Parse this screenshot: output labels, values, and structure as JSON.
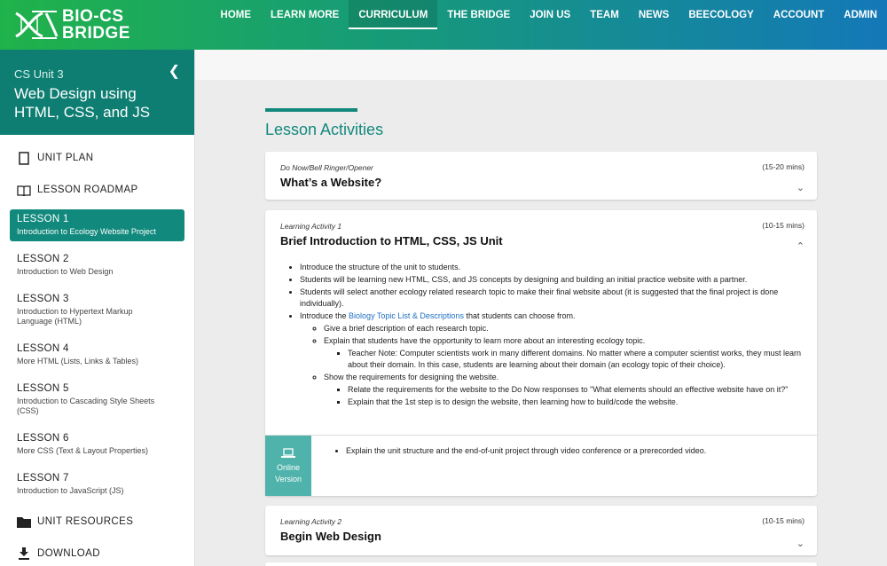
{
  "brand": {
    "line1": "BIO-CS",
    "line2": "BRIDGE"
  },
  "nav": [
    {
      "label": "HOME"
    },
    {
      "label": "LEARN MORE"
    },
    {
      "label": "CURRICULUM"
    },
    {
      "label": "THE BRIDGE"
    },
    {
      "label": "JOIN US"
    },
    {
      "label": "TEAM"
    },
    {
      "label": "NEWS"
    },
    {
      "label": "BEECOLOGY"
    },
    {
      "label": "ACCOUNT"
    },
    {
      "label": "ADMIN"
    }
  ],
  "sidebar": {
    "unit": "CS Unit 3",
    "title": "Web Design using HTML, CSS, and JS",
    "unit_plan": "UNIT PLAN",
    "roadmap": "LESSON ROADMAP",
    "lessons": [
      {
        "name": "LESSON 1",
        "desc": "Introduction to Ecology Website Project"
      },
      {
        "name": "LESSON 2",
        "desc": "Introduction to Web Design"
      },
      {
        "name": "LESSON 3",
        "desc": "Introduction to Hypertext Markup Language (HTML)"
      },
      {
        "name": "LESSON 4",
        "desc": "More HTML (Lists, Links & Tables)"
      },
      {
        "name": "LESSON 5",
        "desc": "Introduction to Cascading Style Sheets (CSS)"
      },
      {
        "name": "LESSON 6",
        "desc": "More CSS (Text & Layout Properties)"
      },
      {
        "name": "LESSON 7",
        "desc": "Introduction to JavaScript (JS)"
      }
    ],
    "resources": "UNIT RESOURCES",
    "download": "DOWNLOAD"
  },
  "main": {
    "section_title": "Lesson Activities",
    "cards": [
      {
        "kind": "Do Now/Bell Ringer/Opener",
        "time": "(15-20 mins)",
        "title": "What’s a Website?"
      },
      {
        "kind": "Learning Activity 1",
        "time": "(10-15 mins)",
        "title": "Brief Introduction to HTML, CSS, JS Unit"
      },
      {
        "kind": "Learning Activity 2",
        "time": "(10-15 mins)",
        "title": "Begin Web Design"
      }
    ],
    "activity1": {
      "b1": "Introduce the structure of the unit to students.",
      "b2": "Students will be learning new HTML, CSS, and JS concepts by designing and building an initial practice website with a partner.",
      "b3": "Students will select another ecology related research topic to make their final website about (it is suggested that the final project is done individually).",
      "b4_pre": "Introduce the ",
      "b4_link": "Biology Topic List & Descriptions",
      "b4_post": " that students can choose from.",
      "s1": "Give a brief description of each research topic.",
      "s2": "Explain that students have the opportunity to learn more about an interesting ecology topic.",
      "s2a": "Teacher Note: Computer scientists work in many different domains. No matter where a computer scientist works, they must learn about their domain. In this case, students are learning about their domain (an ecology topic of their choice).",
      "s3": "Show the requirements for designing the website.",
      "s3a": "Relate the requirements for the website to the Do Now responses to \"What elements should an effective website have on it?\"",
      "s3b": "Explain that the 1st step is to design the website, then learning how to build/code the website.",
      "online_label_1": "Online",
      "online_label_2": "Version",
      "online_text": "Explain the unit structure and the end-of-unit project through video conference or a prerecorded video."
    }
  }
}
